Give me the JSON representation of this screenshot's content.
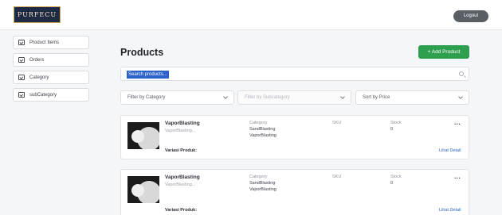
{
  "header": {
    "logo_text": "PURFECU",
    "logout_label": "Logout"
  },
  "sidebar": {
    "items": [
      {
        "label": "Product Items",
        "icon": "checkbox-icon"
      },
      {
        "label": "Orders",
        "icon": "checkbox-icon"
      },
      {
        "label": "Category",
        "icon": "checkbox-icon"
      },
      {
        "label": "subCategory",
        "icon": "checkbox-icon"
      }
    ]
  },
  "main": {
    "title": "Products",
    "add_button": "+ Add Product",
    "search": {
      "value": "Search products..."
    },
    "filters": [
      {
        "label": "Filter by Category"
      },
      {
        "label": "Filter by Subcategory"
      },
      {
        "label": "Sort by Price"
      }
    ],
    "products": [
      {
        "name": "VaporBlasting",
        "description": "VaporBlasting...",
        "category_label": "Category",
        "category_lines": [
          "SandBlasting",
          "VaporBlasting"
        ],
        "sku_label": "SKU",
        "stock_label": "Stock",
        "stock_value": "0",
        "variasi_label": "Variasi Produk:",
        "detail_label": "Lihat Detail",
        "menu_label": "..."
      },
      {
        "name": "VaporBlasting",
        "description": "VaporBlasting...",
        "category_label": "Category",
        "category_lines": [
          "SandBlasting",
          "VaporBlasting"
        ],
        "sku_label": "SKU",
        "stock_label": "Stock",
        "stock_value": "0",
        "variasi_label": "Variasi Produk:",
        "detail_label": "Lihat Detail",
        "menu_label": "..."
      }
    ]
  },
  "colors": {
    "accent_green": "#2e9e4f",
    "link_blue": "#2b62c9",
    "logout_bg": "#5a5f66"
  }
}
